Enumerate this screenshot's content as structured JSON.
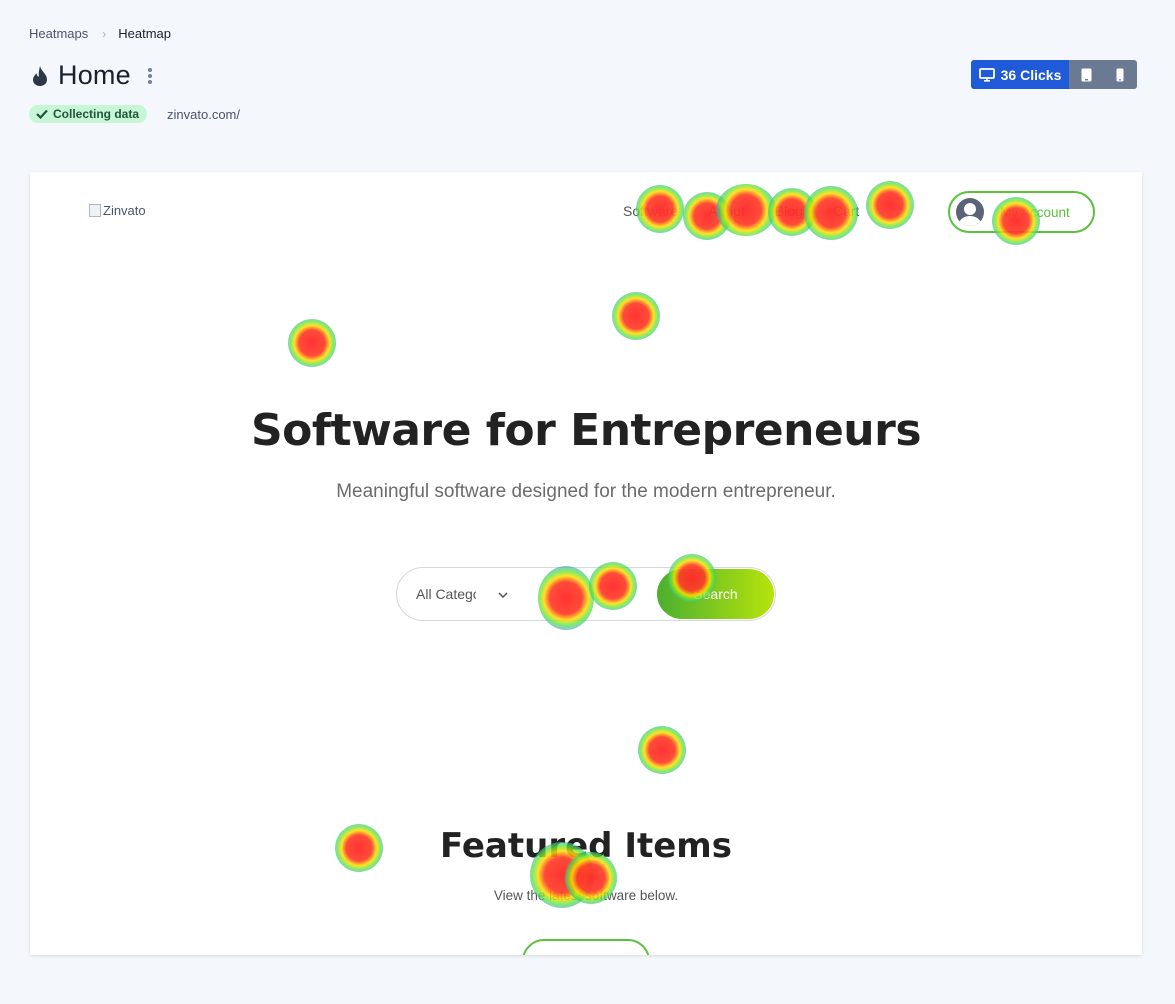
{
  "breadcrumb": {
    "parent": "Heatmaps",
    "separator": "›",
    "current": "Heatmap"
  },
  "header": {
    "title": "Home",
    "status_badge": "Collecting data",
    "url": "zinvato.com/"
  },
  "devices": {
    "desktop_clicks_label": "36 Clicks",
    "active": "desktop",
    "accent": "#1f5ad8"
  },
  "site": {
    "logo_alt": "Zinvato",
    "nav": [
      "Software",
      "About",
      "Blog",
      "Cart"
    ],
    "account_label": "My Account",
    "hero_title": "Software for Entrepreneurs",
    "hero_subtitle": "Meaningful software designed for the modern entrepreneur.",
    "search": {
      "category_value": "All Categories",
      "button_label": "Search"
    },
    "featured_title": "Featured Items",
    "featured_subtitle": "View the latest software below.",
    "brand_green": "#5cbf3e"
  }
}
